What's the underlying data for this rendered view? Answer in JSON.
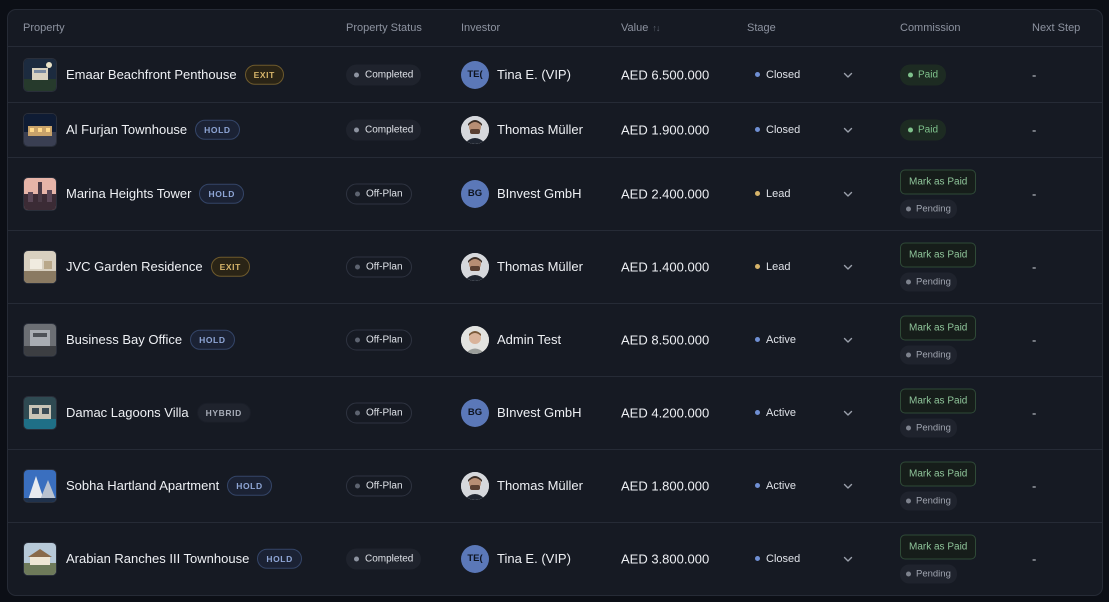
{
  "columns": {
    "property": "Property",
    "status": "Property Status",
    "investor": "Investor",
    "value": "Value",
    "value_sort_icon": "sort-arrows-icon",
    "stage": "Stage",
    "commission": "Commission",
    "next_step": "Next Step"
  },
  "colors": {
    "stage_closed": "#6f8fd3",
    "stage_lead": "#d6b46a",
    "stage_active": "#6f8fd3",
    "paid": "#7fc28c",
    "completed_dot": "#8d93a0",
    "offplan_dot": "#5d6370"
  },
  "rows": [
    {
      "property": "Emaar Beachfront Penthouse",
      "tag": "EXIT",
      "status": "Completed",
      "investor": "Tina E. (VIP)",
      "avatar_initials": "TE(",
      "value": "AED 6.500.000",
      "stage": "Closed",
      "commission_paid": "Paid",
      "next_step": "-"
    },
    {
      "property": "Al Furjan Townhouse",
      "tag": "HOLD",
      "status": "Completed",
      "investor": "Thomas Müller",
      "value": "AED 1.900.000",
      "stage": "Closed",
      "commission_paid": "Paid",
      "next_step": "-"
    },
    {
      "property": "Marina Heights Tower",
      "tag": "HOLD",
      "status": "Off-Plan",
      "investor": "BInvest GmbH",
      "avatar_initials": "BG",
      "value": "AED 2.400.000",
      "stage": "Lead",
      "commission_button": "Mark as Paid",
      "commission_status": "Pending",
      "next_step": "-"
    },
    {
      "property": "JVC Garden Residence",
      "tag": "EXIT",
      "status": "Off-Plan",
      "investor": "Thomas Müller",
      "value": "AED 1.400.000",
      "stage": "Lead",
      "commission_button": "Mark as Paid",
      "commission_status": "Pending",
      "next_step": "-"
    },
    {
      "property": "Business Bay Office",
      "tag": "HOLD",
      "status": "Off-Plan",
      "investor": "Admin Test",
      "value": "AED 8.500.000",
      "stage": "Active",
      "commission_button": "Mark as Paid",
      "commission_status": "Pending",
      "next_step": "-"
    },
    {
      "property": "Damac Lagoons Villa",
      "tag": "HYBRID",
      "status": "Off-Plan",
      "investor": "BInvest GmbH",
      "avatar_initials": "BG",
      "value": "AED 4.200.000",
      "stage": "Active",
      "commission_button": "Mark as Paid",
      "commission_status": "Pending",
      "next_step": "-"
    },
    {
      "property": "Sobha Hartland Apartment",
      "tag": "HOLD",
      "status": "Off-Plan",
      "investor": "Thomas Müller",
      "value": "AED 1.800.000",
      "stage": "Active",
      "commission_button": "Mark as Paid",
      "commission_status": "Pending",
      "next_step": "-"
    },
    {
      "property": "Arabian Ranches III Townhouse",
      "tag": "HOLD",
      "status": "Completed",
      "investor": "Tina E. (VIP)",
      "avatar_initials": "TE(",
      "value": "AED 3.800.000",
      "stage": "Closed",
      "commission_button": "Mark as Paid",
      "commission_status": "Pending",
      "next_step": "-"
    }
  ]
}
